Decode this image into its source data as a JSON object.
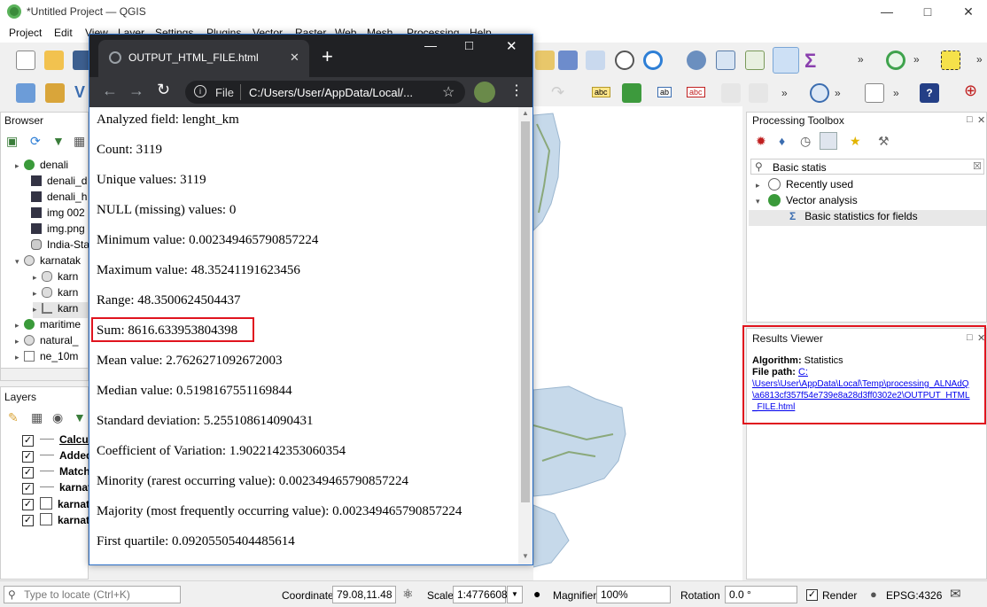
{
  "window": {
    "title": "*Untitled Project — QGIS"
  },
  "menu": [
    "Project",
    "Edit",
    "View",
    "Layer",
    "Settings",
    "Plugins",
    "Vector",
    "Raster",
    "Web",
    "Mesh",
    "Processing",
    "Help"
  ],
  "browser_panel": {
    "title": "Browser",
    "items": [
      "denali",
      "denali_d",
      "denali_h",
      "img 002",
      "img.png",
      "India-Sta",
      "karnatak",
      "karn",
      "karn",
      "karn",
      "maritime",
      "natural_",
      "ne_10m"
    ]
  },
  "layers_panel": {
    "title": "Layers",
    "items": [
      "Calcula",
      "Added",
      "Match",
      "karnat",
      "karnat",
      "karnat"
    ]
  },
  "processing_toolbox": {
    "title": "Processing Toolbox",
    "search": "Basic statis",
    "tree": {
      "recent": "Recently used",
      "vector": "Vector analysis",
      "algorithm": "Basic statistics for fields"
    }
  },
  "results_viewer": {
    "title": "Results Viewer",
    "algorithm_label": "Algorithm:",
    "algorithm_value": "Statistics",
    "filepath_label": "File path:",
    "filepath_lines": [
      "C:",
      "\\Users\\User\\AppData\\Local\\Temp\\processing_ALNAdQ",
      "\\a6813cf357f54e739e8a28d3ff0302e2\\OUTPUT_HTML",
      "_FILE.html"
    ]
  },
  "chrome": {
    "tab_title": "OUTPUT_HTML_FILE.html",
    "address_prefix": "File",
    "address": "C:/Users/User/AppData/Local/...",
    "stats": [
      "Analyzed field: lenght_km",
      "Count: 3119",
      "Unique values: 3119",
      "NULL (missing) values: 0",
      "Minimum value: 0.002349465790857224",
      "Maximum value: 48.35241191623456",
      "Range: 48.3500624504437",
      "Sum: 8616.633953804398",
      "Mean value: 2.7626271092672003",
      "Median value: 0.5198167551169844",
      "Standard deviation: 5.255108614090431",
      "Coefficient of Variation: 1.9022142353060354",
      "Minority (rarest occurring value): 0.002349465790857224",
      "Majority (most frequently occurring value): 0.002349465790857224",
      "First quartile: 0.09205505404485614"
    ]
  },
  "statusbar": {
    "locate_placeholder": "Type to locate (Ctrl+K)",
    "coordinate_label": "Coordinate",
    "coordinate": "79.08,11.48",
    "scale_label": "Scale",
    "scale": "1:4776608",
    "magnifier_label": "Magnifier",
    "magnifier": "100%",
    "rotation_label": "Rotation",
    "rotation": "0.0 °",
    "render_label": "Render",
    "crs": "EPSG:4326"
  },
  "colors": {
    "highlight": "#e0141e",
    "link": "#0000ee",
    "chrome_dark": "#202124"
  }
}
